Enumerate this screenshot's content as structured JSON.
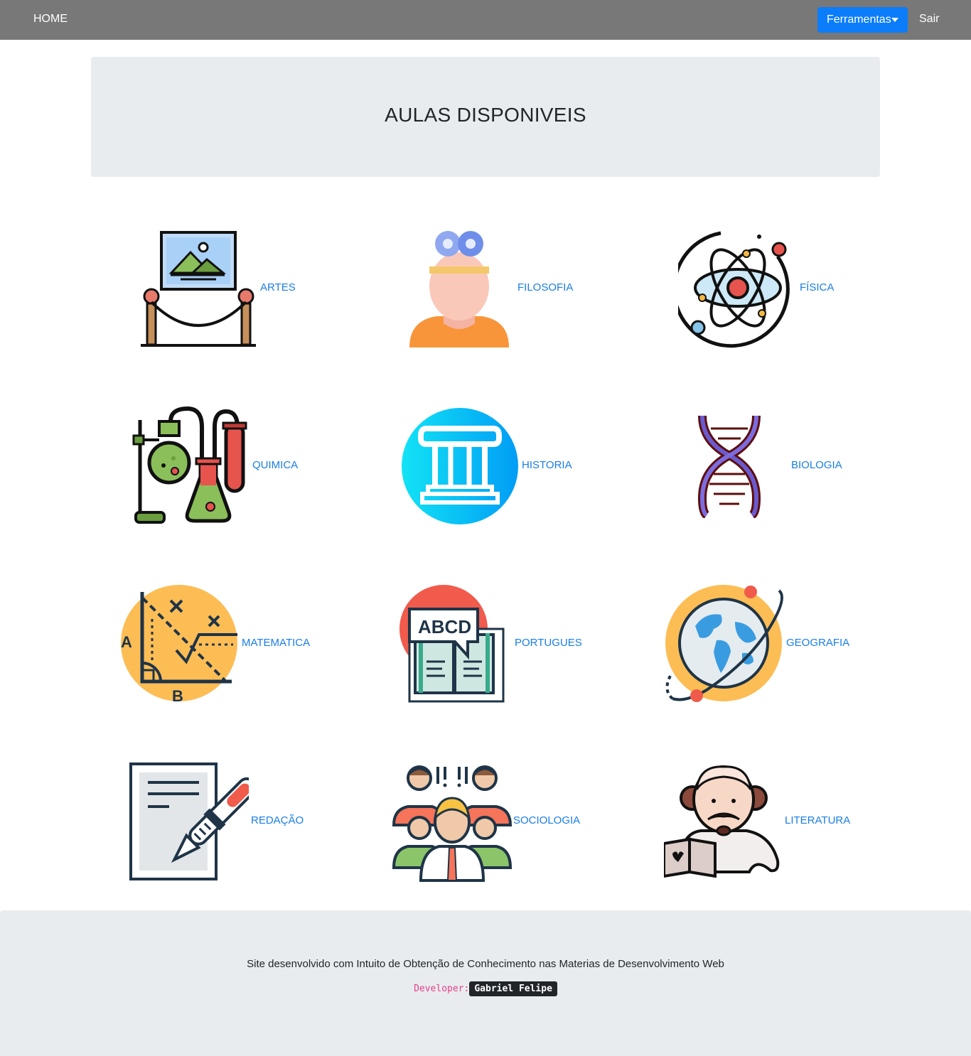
{
  "nav": {
    "home": "HOME",
    "tools": "Ferramentas",
    "exit": "Sair"
  },
  "header": {
    "title": "AULAS DISPONIVEIS"
  },
  "subjects": [
    {
      "label": "ARTES",
      "icon": "art-gallery-icon"
    },
    {
      "label": "FILOSOFIA",
      "icon": "thinker-head-icon"
    },
    {
      "label": "FÍSICA",
      "icon": "atom-icon"
    },
    {
      "label": "QUIMICA",
      "icon": "lab-flasks-icon"
    },
    {
      "label": "HISTORIA",
      "icon": "column-icon"
    },
    {
      "label": "BIOLOGIA",
      "icon": "dna-icon"
    },
    {
      "label": "MATEMATICA",
      "icon": "geometry-icon"
    },
    {
      "label": "PORTUGUES",
      "icon": "abcd-book-icon"
    },
    {
      "label": "GEOGRAFIA",
      "icon": "globe-icon"
    },
    {
      "label": "REDAÇÃO",
      "icon": "pen-paper-icon"
    },
    {
      "label": "SOCIOLOGIA",
      "icon": "people-group-icon"
    },
    {
      "label": "LITERATURA",
      "icon": "shakespeare-icon"
    }
  ],
  "footer": {
    "text": "Site desenvolvido com Intuito de Obtenção de Conhecimento nas Materias de Desenvolvimento Web",
    "dev_label": "Developer:",
    "dev_name": "Gabriel Felipe"
  },
  "colors": {
    "navbar": "#787878",
    "primary": "#0b7dfa",
    "link": "#1a7ee6",
    "panel": "#e9ecef"
  }
}
